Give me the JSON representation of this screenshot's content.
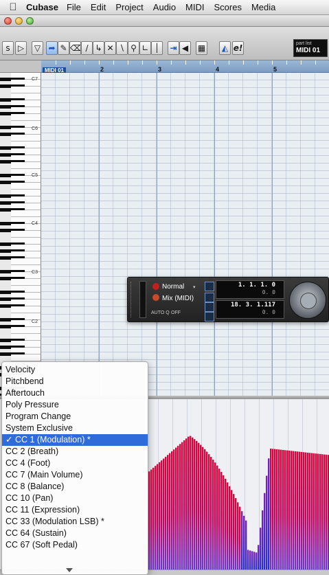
{
  "menubar": {
    "app_name": "Cubase",
    "items": [
      "File",
      "Edit",
      "Project",
      "Audio",
      "MIDI",
      "Scores",
      "Media"
    ]
  },
  "toolbar": {
    "part_list_label": "part list",
    "part_name": "MIDI 01",
    "e_label": "e!"
  },
  "ruler": {
    "part_tag": "MIDI 01",
    "bars": [
      "2",
      "3",
      "4",
      "5"
    ]
  },
  "piano": {
    "octave_labels": [
      "C7",
      "C6",
      "C5",
      "C4",
      "C3",
      "C2"
    ]
  },
  "transport": {
    "mode": "Normal",
    "mix": "Mix (MIDI)",
    "auto_q": "AUTO Q",
    "auto_q_state": "OFF",
    "left_locator": "1. 1. 1.   0",
    "left_sub": "0.    0",
    "right_locator": "18. 3. 1.117",
    "right_sub": "0.    0"
  },
  "controller_menu": {
    "items": [
      "Velocity",
      "Pitchbend",
      "Aftertouch",
      "Poly Pressure",
      "Program Change",
      "System Exclusive",
      "✓ CC 1  (Modulation) *",
      "CC 2  (Breath)",
      "CC 4  (Foot)",
      "CC 7  (Main Volume)",
      "CC 8  (Balance)",
      "CC 10  (Pan)",
      "CC 11  (Expression)",
      "CC 33  (Modulation LSB) *",
      "CC 64  (Sustain)",
      "CC 67  (Soft Pedal)"
    ],
    "selected_index": 6
  },
  "colors": {
    "menu_highlight": "#2f6bd9",
    "ruler_blue": "#8aaad0",
    "controller_red": "#e0003a",
    "controller_purple": "#4a2bd6"
  }
}
